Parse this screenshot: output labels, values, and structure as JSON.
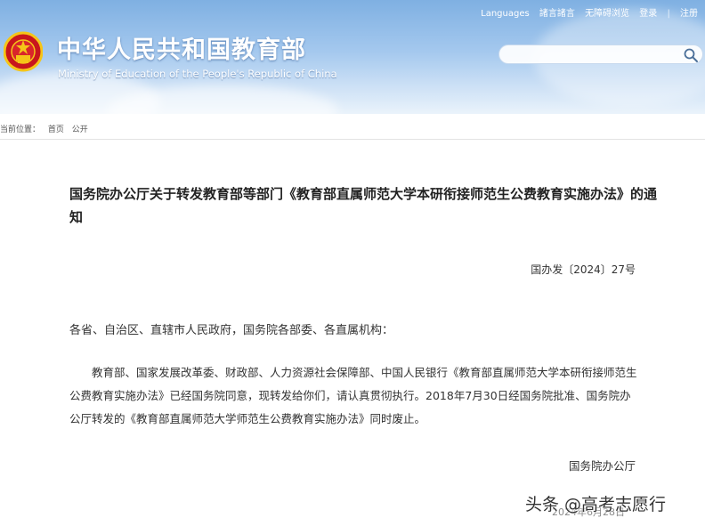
{
  "header": {
    "top_links": [
      "Languages",
      "諸言諸言",
      "无障碍浏览",
      "登录",
      "注册"
    ],
    "title": "中华人民共和国教育部",
    "subtitle": "Ministry of Education of the People's Republic of China",
    "emblem_icon": "national-emblem-icon",
    "colors": {
      "sky_top": "#7fb0e2",
      "sky_bottom": "#eaf3fb",
      "emblem_red": "#c8161d",
      "emblem_gold": "#f5c518"
    }
  },
  "search": {
    "placeholder": "",
    "icon": "search-icon"
  },
  "breadcrumb": {
    "label": "当前位置：",
    "items": [
      "首页",
      "公开"
    ]
  },
  "document": {
    "title": "国务院办公厅关于转发教育部等部门《教育部直属师范大学本研衔接师范生公费教育实施办法》的通知",
    "number": "国办发〔2024〕27号",
    "addressee": "各省、自治区、直辖市人民政府，国务院各部委、各直属机构：",
    "body": "教育部、国家发展改革委、财政部、人力资源社会保障部、中国人民银行《教育部直属师范大学本研衔接师范生公费教育实施办法》已经国务院同意，现转发给你们，请认真贯彻执行。2018年7月30日经国务院批准、国务院办公厅转发的《教育部直属师范大学师范生公费教育实施办法》同时废止。",
    "issuer": "国务院办公厅",
    "date": "2024年6月28日"
  },
  "watermark": "头条 @高考志愿行"
}
